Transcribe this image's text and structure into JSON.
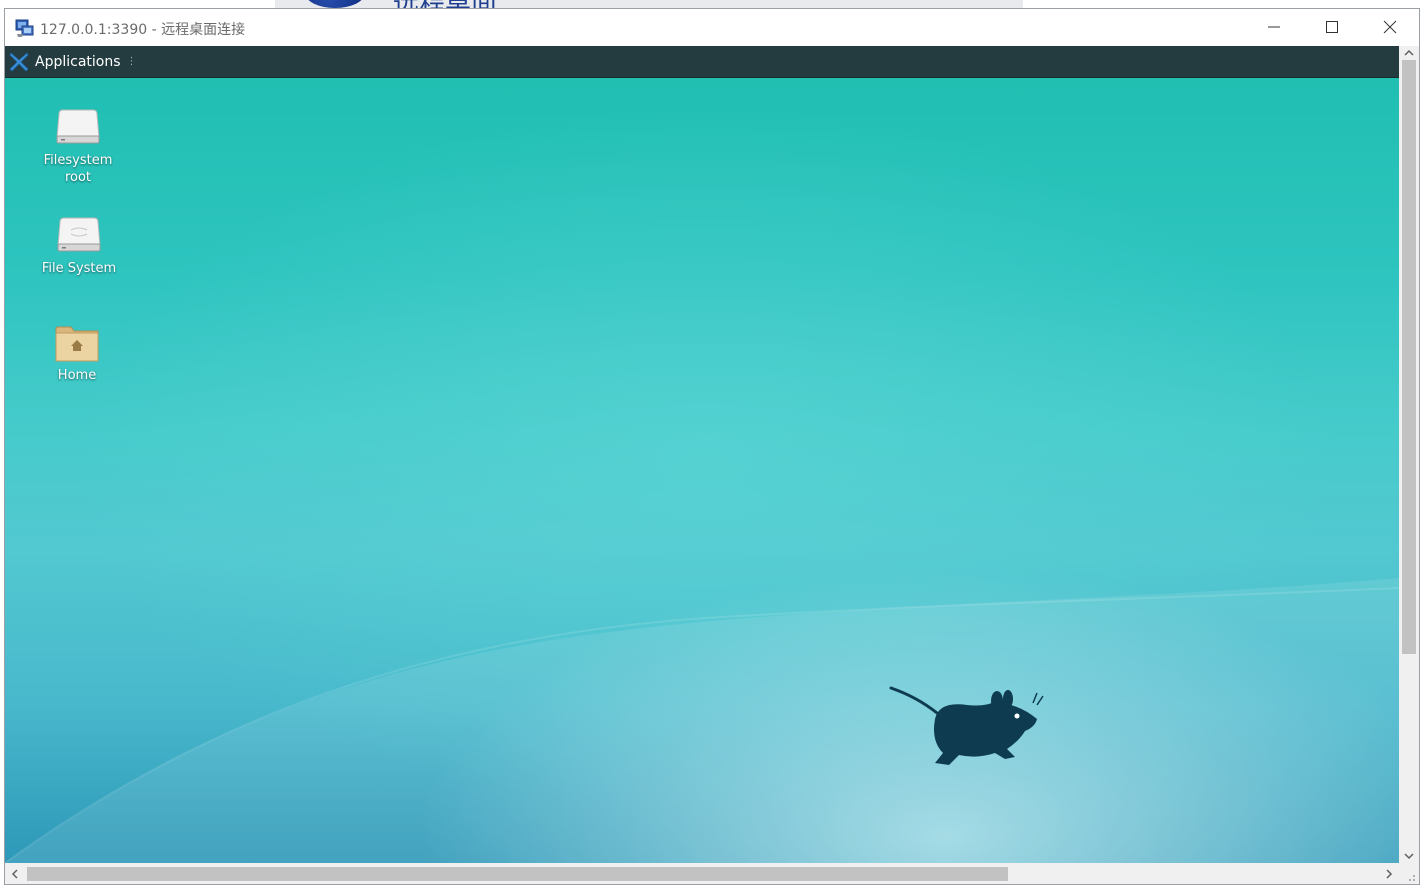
{
  "background_window": {
    "title": "远程桌面"
  },
  "window": {
    "title": "127.0.0.1:3390 - 远程桌面连接",
    "icon": "remote-desktop-icon",
    "buttons": [
      "minimize",
      "maximize",
      "close"
    ]
  },
  "panel": {
    "applications_label": "Applications",
    "grip_glyph": "⋮",
    "logo": "xfce-logo-icon"
  },
  "desktop": {
    "icons": [
      {
        "id": "filesystem-root",
        "label": "Filesystem\nroot",
        "icon": "drive-icon"
      },
      {
        "id": "file-system",
        "label": "File System",
        "icon": "drive-icon"
      },
      {
        "id": "home",
        "label": "Home",
        "icon": "home-folder-icon"
      }
    ],
    "wallpaper_logo": "xfce-mouse-logo"
  },
  "colors": {
    "panel": "#243c3f",
    "desktop_top": "#20bfb2",
    "desktop_bottom": "#2e98b8",
    "mouse": "#0e3b50"
  }
}
